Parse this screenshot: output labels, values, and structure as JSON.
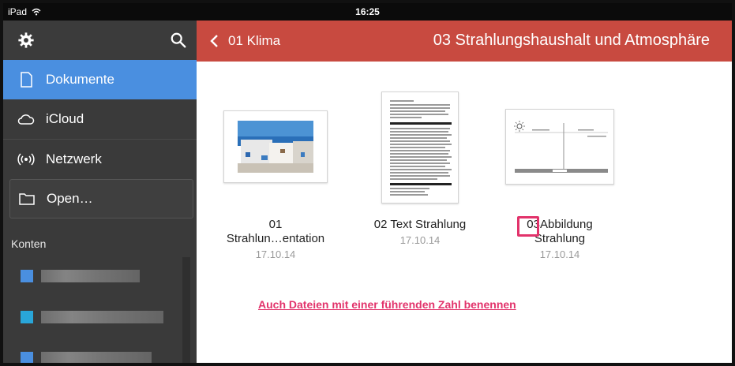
{
  "status": {
    "device": "iPad",
    "time": "16:25"
  },
  "sidebar": {
    "items": [
      {
        "label": "Dokumente",
        "icon": "document-icon"
      },
      {
        "label": "iCloud",
        "icon": "cloud-icon"
      },
      {
        "label": "Netzwerk",
        "icon": "wifi-icon"
      },
      {
        "label": "Open…",
        "icon": "folder-icon"
      }
    ],
    "section_title": "Konten",
    "accounts": [
      {
        "color": "#4a8fe0"
      },
      {
        "color": "#29a6d9"
      },
      {
        "color": "#4a8fe0"
      }
    ]
  },
  "topbar": {
    "back_label": "01 Klima",
    "title": "03 Strahlungshaushalt und Atmosphäre",
    "color": "#c84a40"
  },
  "documents": [
    {
      "line1": "01",
      "line2": "Strahlun…entation",
      "date": "17.10.14"
    },
    {
      "line1": "02 Text Strahlung",
      "line2": "",
      "date": "17.10.14"
    },
    {
      "line1_prefix": "03",
      "line1_rest": "Abbildung",
      "line2": "Strahlung",
      "date": "17.10.14"
    }
  ],
  "annotation": {
    "note": "Auch Dateien mit einer führenden Zahl benennen",
    "color": "#e2336b"
  }
}
